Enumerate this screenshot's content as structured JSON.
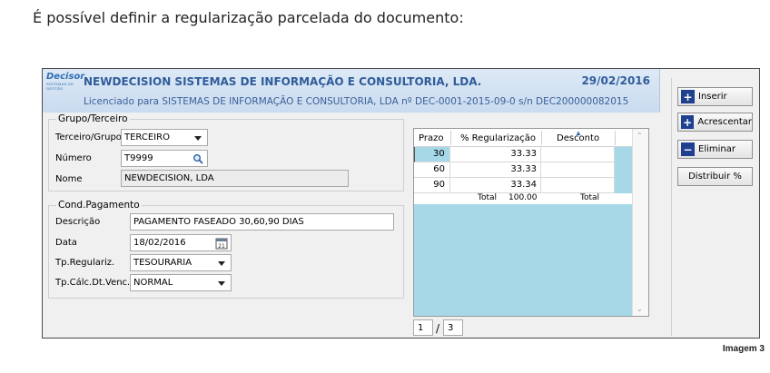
{
  "caption": "É possível definir a regularização parcelada do documento:",
  "image_label": "Imagem 3",
  "header": {
    "logo": "Decisor",
    "logo_sub": "SISTEMAS DE GESTÃO",
    "company": "NEWDECISION SISTEMAS DE INFORMAÇÃO E CONSULTORIA, LDA.",
    "date": "29/02/2016",
    "licensed": "Licenciado para  SISTEMAS DE INFORMAÇÃO E CONSULTORIA, LDA nº DEC-0001-2015-09-0 s/n DEC200000082015"
  },
  "grupo": {
    "title": "Grupo/Terceiro",
    "terceiro_label": "Terceiro/Grupo",
    "terceiro_value": "TERCEIRO",
    "numero_label": "Número",
    "numero_value": "T9999",
    "nome_label": "Nome",
    "nome_value": "NEWDECISION, LDA"
  },
  "cond": {
    "title": "Cond.Pagamento",
    "descricao_label": "Descrição",
    "descricao_value": "PAGAMENTO FASEADO 30,60,90 DIAS",
    "data_label": "Data",
    "data_value": "18/02/2016",
    "tpreg_label": "Tp.Regulariz.",
    "tpreg_value": "TESOURARIA",
    "tpcalc_label": "Tp.Cálc.Dt.Venc.",
    "tpcalc_value": "NORMAL"
  },
  "grid": {
    "headers": [
      "Prazo",
      "% Regularização",
      "Desconto"
    ],
    "rows": [
      {
        "prazo": "30",
        "perc": "33.33",
        "desc": ""
      },
      {
        "prazo": "60",
        "perc": "33.33",
        "desc": ""
      },
      {
        "prazo": "90",
        "perc": "33.34",
        "desc": ""
      }
    ],
    "total_label": "Total",
    "total_value": "100.00",
    "total_label2": "Total"
  },
  "pager": {
    "current": "1",
    "separator": "/",
    "total": "3"
  },
  "buttons": {
    "inserir": "Inserir",
    "acrescentar": "Acrescentar",
    "eliminar": "Eliminar",
    "distribuir": "Distribuir %"
  }
}
